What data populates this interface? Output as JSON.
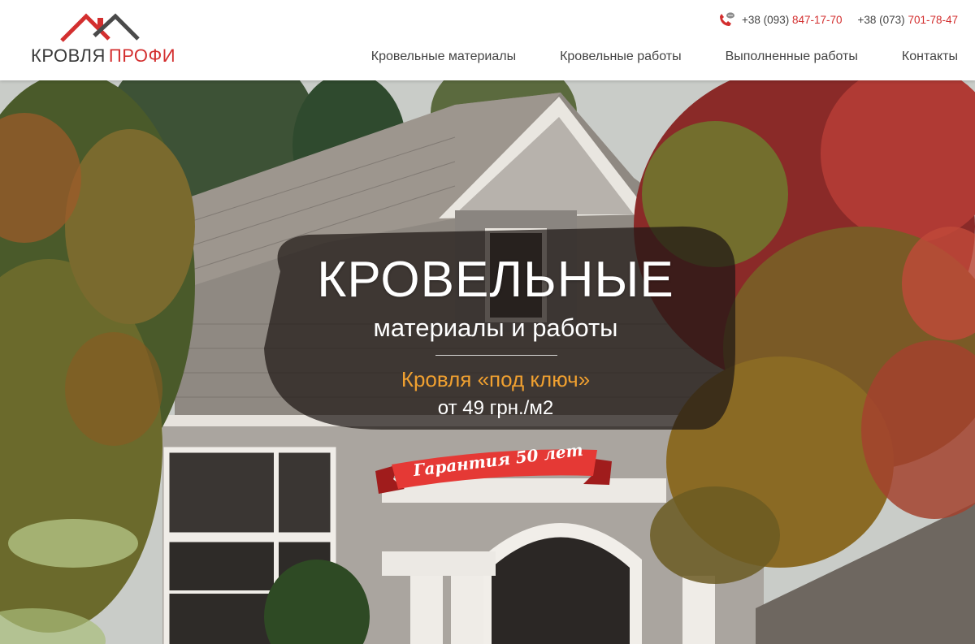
{
  "logo": {
    "word1": "КРОВЛЯ",
    "word2": "ПРОФИ"
  },
  "phones": [
    {
      "prefix": "+38 (093) ",
      "number": "847-17-70"
    },
    {
      "prefix": "+38 (073) ",
      "number": "701-78-47"
    }
  ],
  "nav": [
    {
      "label": "Кровельные материалы"
    },
    {
      "label": "Кровельные работы"
    },
    {
      "label": "Выполненные работы"
    },
    {
      "label": "Контакты"
    }
  ],
  "hero": {
    "title": "КРОВЕЛЬНЫЕ",
    "subtitle": "материалы и работы",
    "turnkey": "Кровля «под ключ»",
    "price": "от 49 грн./м2",
    "ribbon": "Гарантия 50 лет"
  },
  "colors": {
    "accent": "#d32f2f",
    "highlight": "#f0a030",
    "text": "#444444"
  },
  "icons": {
    "phone": "phone-chat-icon",
    "logo": "roof-logo-icon"
  }
}
